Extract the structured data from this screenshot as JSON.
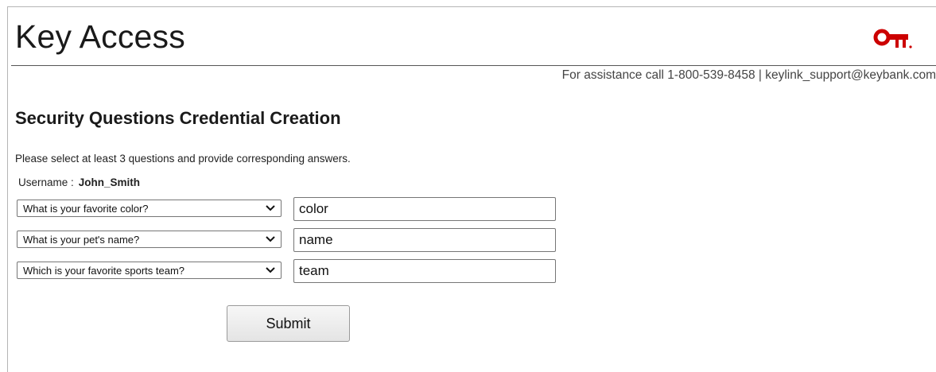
{
  "header": {
    "app_title": "Key Access",
    "assistance": "For assistance call 1-800-539-8458 | keylink_support@keybank.com"
  },
  "colors": {
    "brand_red": "#cc0000",
    "rule": "#555555"
  },
  "main": {
    "page_title": "Security Questions Credential Creation",
    "instructions": "Please select at least 3 questions and provide corresponding answers.",
    "username_label": "Username :",
    "username_value": "John_Smith",
    "questions": [
      {
        "question": "What is your favorite color?",
        "answer": "color"
      },
      {
        "question": "What is your pet's name?",
        "answer": "name"
      },
      {
        "question": "Which is your favorite sports team?",
        "answer": "team"
      }
    ],
    "submit_label": "Submit"
  },
  "icons": {
    "logo": "key-logo-icon",
    "dropdown": "chevron-down-icon"
  }
}
